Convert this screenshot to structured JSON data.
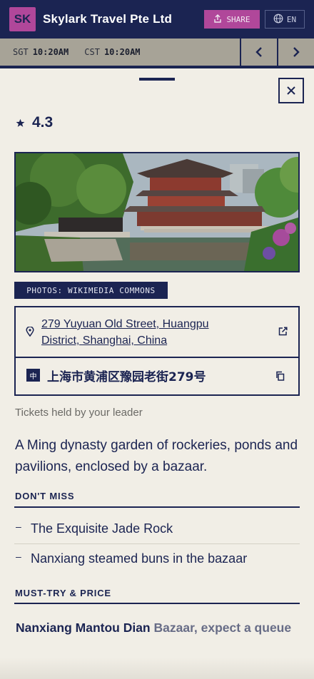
{
  "header": {
    "logo_text": "SK",
    "brand": "Skylark Travel Pte Ltd",
    "share_label": "SHARE",
    "lang_label": "EN",
    "colors": {
      "navy": "#1b2452",
      "magenta": "#b0479a",
      "cream": "#f1eee6"
    }
  },
  "clockbar": {
    "zone1": "SGT",
    "time1": "10:20AM",
    "zone2": "CST",
    "time2": "10:20AM",
    "prev_icon": "chevron-left-icon",
    "next_icon": "chevron-right-icon"
  },
  "detail": {
    "rating": "4.3",
    "photo_alt": "Garden pavilion beside a pond",
    "photo_credit": "PHOTOS: WIKIMEDIA COMMONS",
    "address_en": "279 Yuyuan Old Street, Huangpu District, Shanghai, China",
    "zh_badge": "中",
    "address_zh": "上海市黄浦区豫园老街279号",
    "tickets_note": "Tickets held by your leader",
    "description": "A Ming dynasty garden of rockeries, ponds and pavilions, enclosed by a bazaar.",
    "dont_miss_title": "DON'T MISS",
    "dont_miss": [
      {
        "text": "The Exquisite Jade Rock"
      },
      {
        "text": "Nanxiang steamed buns in the bazaar"
      }
    ],
    "must_try_title": "MUST-TRY & PRICE",
    "must_try_name": "Nanxiang Mantou Dian",
    "must_try_note": "Bazaar, expect a queue"
  }
}
